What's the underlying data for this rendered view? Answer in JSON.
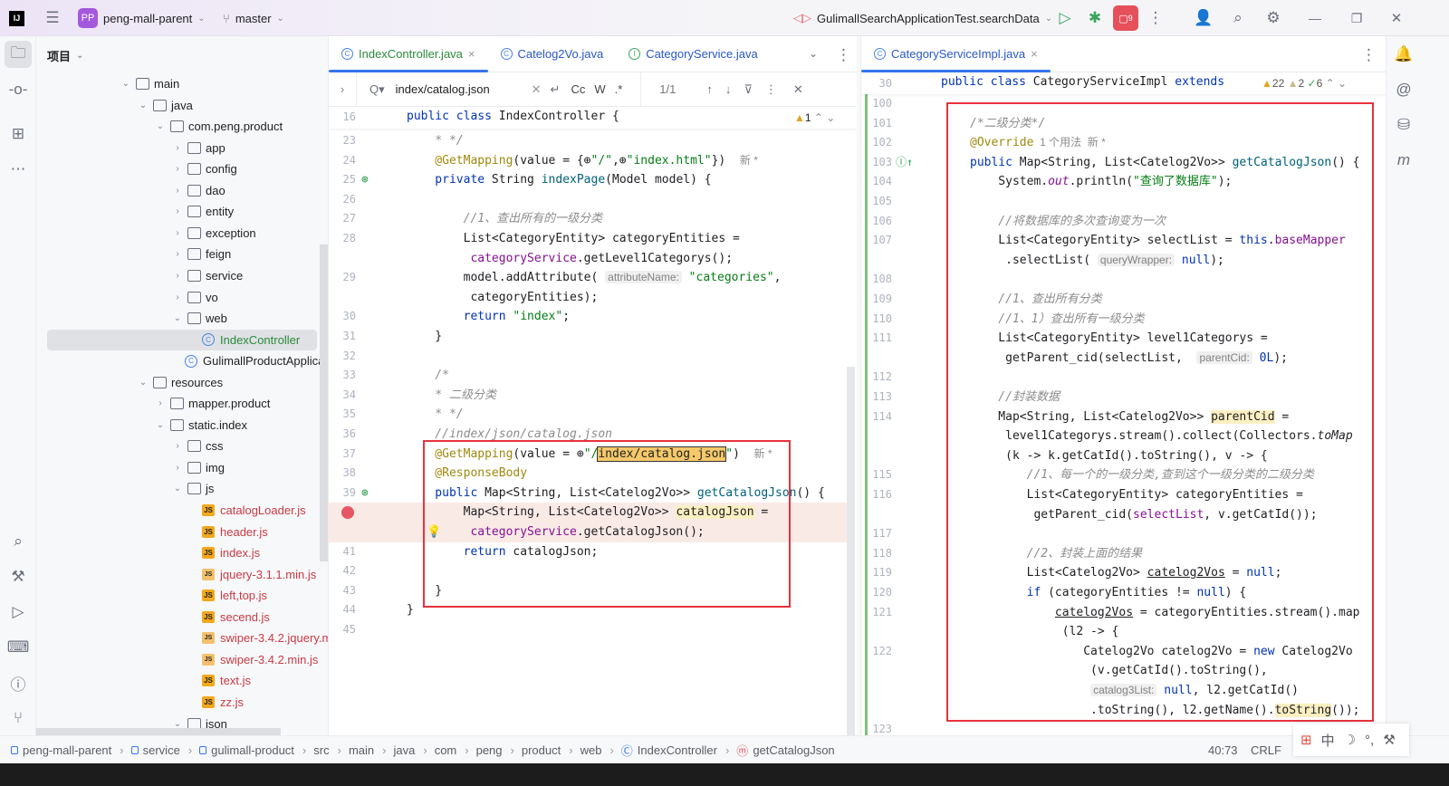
{
  "topbar": {
    "project_initials": "PP",
    "project": "peng-mall-parent",
    "branch": "master",
    "run_config": "GulimallSearchApplicationTest.searchData",
    "badge_count": "9"
  },
  "project_panel": {
    "title": "项目"
  },
  "tree": [
    {
      "label": "main",
      "depth": 0,
      "type": "folder",
      "chev": "open"
    },
    {
      "label": "java",
      "depth": 1,
      "type": "folder",
      "chev": "open"
    },
    {
      "label": "com.peng.product",
      "depth": 2,
      "type": "folder",
      "chev": "open"
    },
    {
      "label": "app",
      "depth": 3,
      "type": "folder",
      "chev": "closed"
    },
    {
      "label": "config",
      "depth": 3,
      "type": "folder",
      "chev": "closed"
    },
    {
      "label": "dao",
      "depth": 3,
      "type": "folder",
      "chev": "closed"
    },
    {
      "label": "entity",
      "depth": 3,
      "type": "folder",
      "chev": "closed"
    },
    {
      "label": "exception",
      "depth": 3,
      "type": "folder",
      "chev": "closed"
    },
    {
      "label": "feign",
      "depth": 3,
      "type": "folder",
      "chev": "closed"
    },
    {
      "label": "service",
      "depth": 3,
      "type": "folder",
      "chev": "closed"
    },
    {
      "label": "vo",
      "depth": 3,
      "type": "folder",
      "chev": "closed"
    },
    {
      "label": "web",
      "depth": 3,
      "type": "folder",
      "chev": "open"
    },
    {
      "label": "IndexController",
      "depth": 4,
      "type": "class",
      "selected": true
    },
    {
      "label": "GulimallProductApplication",
      "depth": 3,
      "type": "class"
    },
    {
      "label": "resources",
      "depth": 1,
      "type": "folder",
      "chev": "open"
    },
    {
      "label": "mapper.product",
      "depth": 2,
      "type": "folder",
      "chev": "closed"
    },
    {
      "label": "static.index",
      "depth": 2,
      "type": "folder",
      "chev": "open"
    },
    {
      "label": "css",
      "depth": 3,
      "type": "folder",
      "chev": "closed"
    },
    {
      "label": "img",
      "depth": 3,
      "type": "folder",
      "chev": "closed"
    },
    {
      "label": "js",
      "depth": 3,
      "type": "folder",
      "chev": "open"
    },
    {
      "label": "catalogLoader.js",
      "depth": 4,
      "type": "js"
    },
    {
      "label": "header.js",
      "depth": 4,
      "type": "js"
    },
    {
      "label": "index.js",
      "depth": 4,
      "type": "js"
    },
    {
      "label": "jquery-3.1.1.min.js",
      "depth": 4,
      "type": "lib"
    },
    {
      "label": "left,top.js",
      "depth": 4,
      "type": "js"
    },
    {
      "label": "secend.js",
      "depth": 4,
      "type": "js"
    },
    {
      "label": "swiper-3.4.2.jquery.min.js",
      "depth": 4,
      "type": "lib"
    },
    {
      "label": "swiper-3.4.2.min.js",
      "depth": 4,
      "type": "lib"
    },
    {
      "label": "text.js",
      "depth": 4,
      "type": "js"
    },
    {
      "label": "zz.js",
      "depth": 4,
      "type": "js"
    },
    {
      "label": "json",
      "depth": 3,
      "type": "folder",
      "chev": "open"
    }
  ],
  "left_editor": {
    "tabs": [
      {
        "label": "IndexController.java",
        "icon": "C",
        "active": true,
        "close": "×"
      },
      {
        "label": "Catelog2Vo.java",
        "icon": "C"
      },
      {
        "label": "CategoryService.java",
        "icon": "I"
      }
    ],
    "find": {
      "query": "index/catalog.json",
      "match_count": "1/1",
      "case": "Cc",
      "words": "W",
      "regex": ".*"
    },
    "sticky": {
      "num": "16",
      "tokens": [
        [
          "kw",
          "public class "
        ],
        [
          "",
          "IndexController {"
        ]
      ]
    },
    "inspections": "1",
    "lines": [
      {
        "n": "23",
        "t": [
          [
            "cm",
            "    * */"
          ]
        ]
      },
      {
        "n": "24",
        "t": [
          [
            "ann",
            "    @GetMapping"
          ],
          [
            "",
            "(value = {⊕"
          ],
          [
            "str",
            "\"/\""
          ],
          [
            "",
            ",⊕"
          ],
          [
            "str",
            "\"index.html\""
          ],
          [
            "",
            "})  "
          ],
          [
            "meta",
            "新 *"
          ]
        ]
      },
      {
        "n": "25",
        "g": "bean",
        "t": [
          [
            "kw",
            "    private "
          ],
          [
            "",
            "String "
          ],
          [
            "fn",
            "indexPage"
          ],
          [
            "",
            "(Model model) {"
          ]
        ]
      },
      {
        "n": "26",
        "t": []
      },
      {
        "n": "27",
        "t": [
          [
            "cm",
            "        //1、查出所有的一级分类"
          ]
        ]
      },
      {
        "n": "28",
        "t": [
          [
            "",
            "        List<CategoryEntity> categoryEntities ="
          ]
        ]
      },
      {
        "n": "",
        "t": [
          [
            "fld",
            "         categoryService"
          ],
          [
            "",
            ".getLevel1Categorys();"
          ]
        ]
      },
      {
        "n": "29",
        "t": [
          [
            "",
            "        model.addAttribute( "
          ],
          [
            "hint",
            "attributeName:"
          ],
          [
            "str",
            " \"categories\""
          ],
          [
            "",
            ","
          ]
        ]
      },
      {
        "n": "",
        "t": [
          [
            "",
            "         categoryEntities);"
          ]
        ]
      },
      {
        "n": "30",
        "t": [
          [
            "kw",
            "        return "
          ],
          [
            "str",
            "\"index\""
          ],
          [
            "",
            ";"
          ]
        ]
      },
      {
        "n": "31",
        "t": [
          [
            "",
            "    }"
          ]
        ]
      },
      {
        "n": "32",
        "t": []
      },
      {
        "n": "33",
        "t": [
          [
            "cm",
            "    /*"
          ]
        ]
      },
      {
        "n": "34",
        "t": [
          [
            "cm",
            "    * 二级分类"
          ]
        ]
      },
      {
        "n": "35",
        "t": [
          [
            "cm",
            "    * */"
          ]
        ]
      },
      {
        "n": "36",
        "t": [
          [
            "cm",
            "    //index/json/catalog.json"
          ]
        ]
      },
      {
        "n": "37",
        "t": [
          [
            "ann",
            "    @GetMapping"
          ],
          [
            "",
            "(value = ⊕"
          ],
          [
            "str",
            "\"/"
          ],
          [
            "found",
            "index/catalog.json"
          ],
          [
            "str",
            "\""
          ],
          [
            "",
            ")  "
          ],
          [
            "meta",
            "新 *"
          ]
        ]
      },
      {
        "n": "38",
        "t": [
          [
            "ann",
            "    @ResponseBody"
          ]
        ]
      },
      {
        "n": "39",
        "g": "bean",
        "t": [
          [
            "kw",
            "    public "
          ],
          [
            "",
            "Map<String, List<Catelog2Vo>> "
          ],
          [
            "fn",
            "getCatalogJson"
          ],
          [
            "",
            "() {"
          ]
        ]
      },
      {
        "n": "",
        "g": "breakpoint",
        "bp": true,
        "t": [
          [
            "",
            "        Map<String, List<Catelog2Vo>> "
          ],
          [
            "hl",
            "catalogJson"
          ],
          [
            "",
            " ="
          ]
        ]
      },
      {
        "n": "",
        "g": "bulb",
        "bp": true,
        "t": [
          [
            "fld",
            "         categoryService"
          ],
          [
            "",
            ".getCatalogJson();"
          ]
        ]
      },
      {
        "n": "41",
        "t": [
          [
            "kw",
            "        return "
          ],
          [
            "",
            "catalogJson;"
          ]
        ]
      },
      {
        "n": "42",
        "t": []
      },
      {
        "n": "43",
        "t": [
          [
            "",
            "    }"
          ]
        ]
      },
      {
        "n": "44",
        "t": [
          [
            "",
            "}"
          ]
        ]
      },
      {
        "n": "45",
        "t": []
      }
    ]
  },
  "right_editor": {
    "tabs": [
      {
        "label": "CategoryServiceImpl.java",
        "icon": "C",
        "active": true,
        "close": "×"
      }
    ],
    "sticky": {
      "num": "30",
      "tokens": [
        [
          "kw",
          "public class "
        ],
        [
          "",
          "CategoryServiceImpl "
        ],
        [
          "kw",
          "extends"
        ]
      ]
    },
    "warnings": "22",
    "weak_warnings": "2",
    "ok": "6",
    "lines": [
      {
        "n": "100",
        "t": []
      },
      {
        "n": "101",
        "t": [
          [
            "cm",
            "/*二级分类*/"
          ]
        ]
      },
      {
        "n": "102",
        "t": [
          [
            "ann",
            "@Override"
          ],
          [
            "meta",
            "  1 个用法  新 *"
          ]
        ]
      },
      {
        "n": "103",
        "g": "impl",
        "t": [
          [
            "kw",
            "public "
          ],
          [
            "",
            "Map<String, List<Catelog2Vo>> "
          ],
          [
            "fn",
            "getCatalogJson"
          ],
          [
            "",
            "() {"
          ]
        ]
      },
      {
        "n": "104",
        "t": [
          [
            "",
            "    System."
          ],
          [
            "fld it",
            "out"
          ],
          [
            "",
            ".println("
          ],
          [
            "str",
            "\"查询了数据库\""
          ],
          [
            "",
            ");"
          ]
        ]
      },
      {
        "n": "105",
        "t": []
      },
      {
        "n": "106",
        "t": [
          [
            "cm",
            "    //将数据库的多次查询变为一次"
          ]
        ]
      },
      {
        "n": "107",
        "t": [
          [
            "",
            "    List<CategoryEntity> selectList = "
          ],
          [
            "kw",
            "this"
          ],
          [
            "",
            "."
          ],
          [
            "fld",
            "baseMapper"
          ]
        ]
      },
      {
        "n": "",
        "t": [
          [
            "",
            "     .selectList( "
          ],
          [
            "hint",
            "queryWrapper:"
          ],
          [
            "kw",
            " null"
          ],
          [
            "",
            ");"
          ]
        ]
      },
      {
        "n": "108",
        "t": []
      },
      {
        "n": "109",
        "t": [
          [
            "cm",
            "    //1、查出所有分类"
          ]
        ]
      },
      {
        "n": "110",
        "t": [
          [
            "cm",
            "    //1、1）查出所有一级分类"
          ]
        ]
      },
      {
        "n": "111",
        "t": [
          [
            "",
            "    List<CategoryEntity> level1Categorys ="
          ]
        ]
      },
      {
        "n": "",
        "t": [
          [
            "",
            "     getParent_cid(selectList,  "
          ],
          [
            "hint",
            "parentCid:"
          ],
          [
            "kw",
            " 0L"
          ],
          [
            "",
            ");"
          ]
        ]
      },
      {
        "n": "112",
        "t": []
      },
      {
        "n": "113",
        "t": [
          [
            "cm",
            "    //封装数据"
          ]
        ]
      },
      {
        "n": "114",
        "t": [
          [
            "",
            "    Map<String, List<Catelog2Vo>> "
          ],
          [
            "hl",
            "parentCid"
          ],
          [
            "",
            " ="
          ]
        ]
      },
      {
        "n": "",
        "t": [
          [
            "",
            "     level1Categorys.stream().collect(Collectors."
          ],
          [
            "it",
            "toMap"
          ]
        ]
      },
      {
        "n": "",
        "t": [
          [
            "",
            "     (k -> k.getCatId().toString(), v -> {"
          ]
        ]
      },
      {
        "n": "115",
        "t": [
          [
            "cm",
            "        //1、每一个的一级分类,查到这个一级分类的二级分类"
          ]
        ]
      },
      {
        "n": "116",
        "t": [
          [
            "",
            "        List<CategoryEntity> categoryEntities ="
          ]
        ]
      },
      {
        "n": "",
        "t": [
          [
            "",
            "         getParent_cid("
          ],
          [
            "fld",
            "selectList"
          ],
          [
            "",
            ", v.getCatId());"
          ]
        ]
      },
      {
        "n": "117",
        "t": []
      },
      {
        "n": "118",
        "t": [
          [
            "cm",
            "        //2、封装上面的结果"
          ]
        ]
      },
      {
        "n": "119",
        "t": [
          [
            "",
            "        List<Catelog2Vo> "
          ],
          [
            "ul",
            "catelog2Vos"
          ],
          [
            "",
            " = "
          ],
          [
            "kw",
            "null"
          ],
          [
            "",
            ";"
          ]
        ]
      },
      {
        "n": "120",
        "t": [
          [
            "kw",
            "        if "
          ],
          [
            "",
            "(categoryEntities != "
          ],
          [
            "kw",
            "null"
          ],
          [
            "",
            ") {"
          ]
        ]
      },
      {
        "n": "121",
        "t": [
          [
            "",
            "            "
          ],
          [
            "ul",
            "catelog2Vos"
          ],
          [
            "",
            " = categoryEntities.stream().map"
          ]
        ]
      },
      {
        "n": "",
        "t": [
          [
            "",
            "             (l2 -> {"
          ]
        ]
      },
      {
        "n": "122",
        "t": [
          [
            "",
            "                Catelog2Vo catelog2Vo = "
          ],
          [
            "kw",
            "new "
          ],
          [
            "",
            "Catelog2Vo"
          ]
        ]
      },
      {
        "n": "",
        "t": [
          [
            "",
            "                 (v.getCatId().toString(),"
          ]
        ]
      },
      {
        "n": "",
        "t": [
          [
            "",
            "                 "
          ],
          [
            "hint",
            "catalog3List:"
          ],
          [
            "kw",
            " null"
          ],
          [
            "",
            ", l2.getCatId()"
          ]
        ]
      },
      {
        "n": "",
        "t": [
          [
            "",
            "                 .toString(), l2.getName()."
          ],
          [
            "hl",
            "toString"
          ],
          [
            "",
            "());"
          ]
        ]
      },
      {
        "n": "123",
        "t": []
      }
    ]
  },
  "statusbar": {
    "crumbs": [
      "peng-mall-parent",
      "service",
      "gulimall-product",
      "src",
      "main",
      "java",
      "com",
      "peng",
      "product",
      "web",
      "IndexController",
      "getCatalogJson"
    ],
    "position": "40:73",
    "line_ending": "CRLF",
    "ime": "中"
  },
  "colors": {
    "accent": "#3574f0",
    "highlight_box": "#e8323c",
    "breakpoint": "#e55765",
    "keyword": "#0033b3",
    "string": "#067d17",
    "annotation": "#9e880d"
  }
}
